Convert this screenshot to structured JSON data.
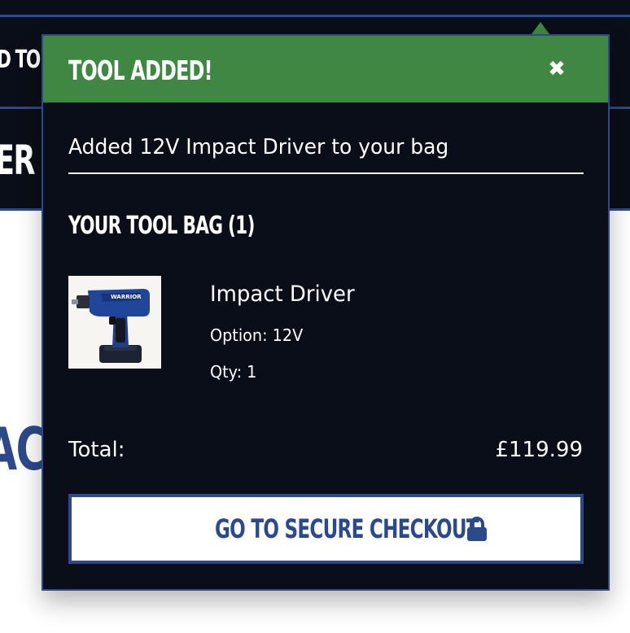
{
  "background": {
    "nav_fragment_top": "D TO",
    "nav_fragment_bottom": "ER",
    "heading_fragment": "AC"
  },
  "popup": {
    "title": "TOOL ADDED!",
    "close_icon": "close-icon",
    "added_message": "Added 12V Impact Driver to your bag",
    "bag_heading": "YOUR TOOL BAG (1)",
    "item": {
      "brand_on_image": "WARRIOR",
      "name": "Impact Driver",
      "option": "Option: 12V",
      "qty": "Qty: 1"
    },
    "total_label": "Total:",
    "total_value": "£119.99",
    "checkout_label": "GO TO SECURE CHECKOUT",
    "checkout_icon": "lock-icon"
  },
  "colors": {
    "navy": "#0a0e18",
    "accent_blue": "#2c4a8a",
    "success_green": "#3f8742",
    "white": "#ffffff"
  }
}
